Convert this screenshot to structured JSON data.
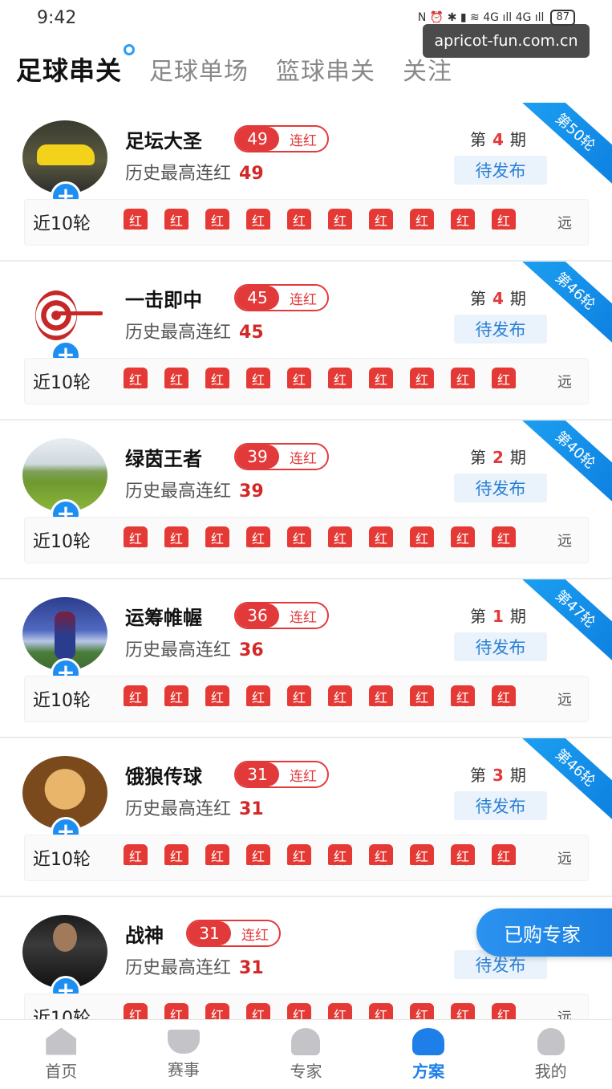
{
  "status_bar": {
    "time": "9:42",
    "icons": "N ⏰ ✱ ▮ ≋ 4G ıll 4G ıll",
    "battery": "87"
  },
  "watermark": "apricot-fun.com.cn",
  "tabs": [
    {
      "label": "足球串关"
    },
    {
      "label": "足球单场"
    },
    {
      "label": "篮球串关"
    },
    {
      "label": "关注"
    }
  ],
  "common": {
    "streak_label": "连红",
    "history_prefix": "历史最高连红",
    "period_prefix": "第",
    "period_suffix": "期",
    "pending_label": "待发布",
    "recent_label": "近10轮",
    "result_text": "红",
    "more_text": "远",
    "follow_symbol": "+"
  },
  "experts": [
    {
      "name": "足坛大圣",
      "streak": "49",
      "history": "49",
      "period": "4",
      "round": "第50轮",
      "avatar": "car"
    },
    {
      "name": "一击即中",
      "streak": "45",
      "history": "45",
      "period": "4",
      "round": "第46轮",
      "avatar": "target"
    },
    {
      "name": "绿茵王者",
      "streak": "39",
      "history": "39",
      "period": "2",
      "round": "第40轮",
      "avatar": "field"
    },
    {
      "name": "运筹帷幄",
      "streak": "36",
      "history": "36",
      "period": "1",
      "round": "第47轮",
      "avatar": "player"
    },
    {
      "name": "饿狼传球",
      "streak": "31",
      "history": "31",
      "period": "3",
      "round": "第46轮",
      "avatar": "face"
    },
    {
      "name": "战神",
      "streak": "31",
      "history": "31",
      "period": "",
      "round": "",
      "avatar": "man"
    }
  ],
  "bought_experts_label": "已购专家",
  "bottom_nav": [
    {
      "label": "首页",
      "icon": "home-icon"
    },
    {
      "label": "赛事",
      "icon": "trophy-icon"
    },
    {
      "label": "专家",
      "icon": "expert-icon"
    },
    {
      "label": "方案",
      "icon": "plan-icon",
      "active": true
    },
    {
      "label": "我的",
      "icon": "profile-icon"
    }
  ],
  "colors": {
    "accent": "#1f7fe8",
    "streak_red": "#e23a3a"
  }
}
